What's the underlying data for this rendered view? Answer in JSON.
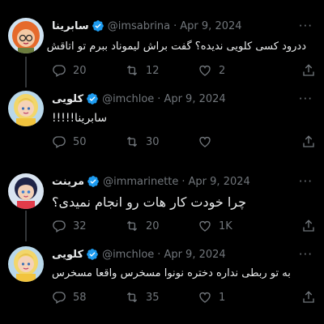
{
  "tweets": [
    {
      "name": "سابرینا",
      "handle": "@imsabrina",
      "date": "Apr 9, 2024",
      "text": "ددرود کسی کلویی ندیده؟ گفت براش لیموناد ببرم تو اتاقش",
      "replies": "20",
      "retweets": "12",
      "likes": "2",
      "avatar_icon": "cartoon-girl-red-hair-glasses"
    },
    {
      "name": "کلویی",
      "handle": "@imchloe",
      "date": "Apr 9, 2024",
      "text": "سابرینا!!!!!",
      "replies": "50",
      "retweets": "30",
      "likes": "",
      "avatar_icon": "cartoon-girl-blonde"
    },
    {
      "name": "مرینت",
      "handle": "@immarinette",
      "date": "Apr 9, 2024",
      "text": "چرا خودت کار هات رو انجام نمیدی؟",
      "replies": "32",
      "retweets": "20",
      "likes": "1K",
      "avatar_icon": "cartoon-girl-dark-hair"
    },
    {
      "name": "کلویی",
      "handle": "@imchloe",
      "date": "Apr 9, 2024",
      "text": "به تو ربطی نداره دختره نونوا مسخرس واقعا مسخرس",
      "replies": "58",
      "retweets": "35",
      "likes": "1",
      "avatar_icon": "cartoon-girl-blonde"
    }
  ],
  "more_glyph": "···",
  "colors": {
    "background": "#000000",
    "text": "#e7e9ea",
    "muted": "#71767b",
    "verified": "#1d9bf0",
    "thread_line": "#333639"
  }
}
